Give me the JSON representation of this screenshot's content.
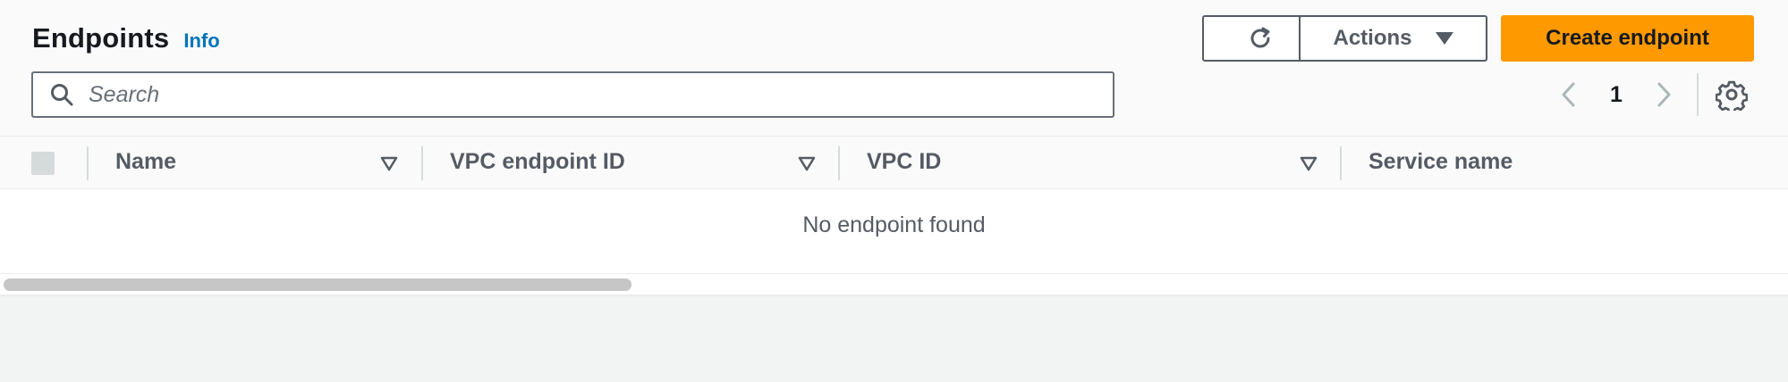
{
  "header": {
    "title": "Endpoints",
    "info_label": "Info"
  },
  "toolbar": {
    "refresh_icon": "refresh-icon",
    "actions_label": "Actions",
    "create_label": "Create endpoint",
    "create_color": "#ff9900"
  },
  "search": {
    "placeholder": "Search",
    "value": ""
  },
  "pagination": {
    "current_page": "1",
    "prev_icon": "chevron-left-icon",
    "next_icon": "chevron-right-icon",
    "settings_icon": "gear-icon"
  },
  "table": {
    "columns": [
      {
        "label": "Name"
      },
      {
        "label": "VPC endpoint ID"
      },
      {
        "label": "VPC ID"
      },
      {
        "label": "Service name"
      }
    ],
    "empty_message": "No endpoint found"
  }
}
